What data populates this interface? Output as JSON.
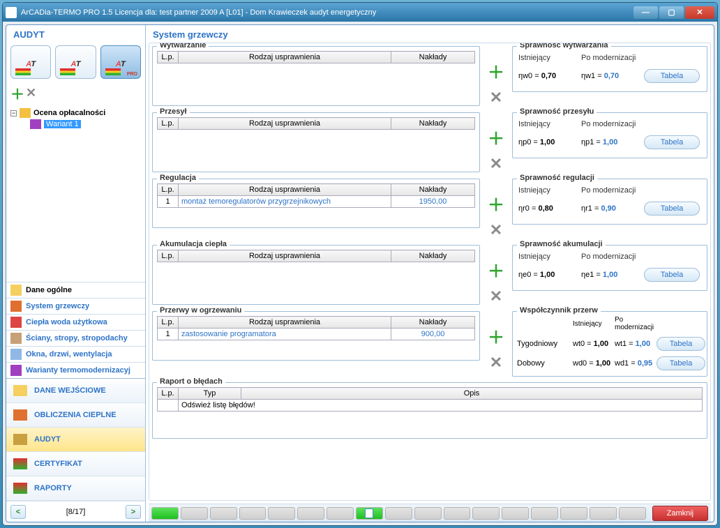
{
  "window": {
    "title": "ArCADia-TERMO PRO 1.5 Licencja dla: test partner 2009 A [L01] - Dom Krawieczek audyt energetyczny"
  },
  "sidebar": {
    "title": "AUDYT",
    "tree": {
      "root_label": "Ocena opłacalności",
      "child_label": "Wariant 1"
    },
    "nav": [
      "Dane ogólne",
      "System grzewczy",
      "Ciepła woda użytkowa",
      "Ściany, stropy, stropodachy",
      "Okna, drzwi, wentylacja",
      "Warianty termomodernizacyj"
    ],
    "big": [
      "DANE WEJŚCIOWE",
      "OBLICZENIA CIEPLNE",
      "AUDYT",
      "CERTYFIKAT",
      "RAPORTY"
    ],
    "pager": "[8/17]"
  },
  "main": {
    "title": "System grzewczy",
    "col_lp": "L.p.",
    "col_rodzaj": "Rodzaj usprawnienia",
    "col_naklady": "Nakłady",
    "istniejacy": "Istniejący",
    "po_modern": "Po modernizacji",
    "tabela": "Tabela",
    "sections": {
      "wytwarzanie": {
        "legend": "Wytwarzanie",
        "right_title": "Sprawność wytwarzania",
        "sym0": "ηw0 =",
        "val0": "0,70",
        "sym1": "ηw1 =",
        "val1": "0,70"
      },
      "przesyl": {
        "legend": "Przesył",
        "right_title": "Sprawność przesyłu",
        "sym0": "ηp0 =",
        "val0": "1,00",
        "sym1": "ηp1 =",
        "val1": "1,00"
      },
      "regulacja": {
        "legend": "Regulacja",
        "right_title": "Sprawność regulacji",
        "row_lp": "1",
        "row_name": "montaż temoregulatorów przygrzejnikowych",
        "row_cost": "1950,00",
        "sym0": "ηr0 =",
        "val0": "0,80",
        "sym1": "ηr1 =",
        "val1": "0,90"
      },
      "akumulacja": {
        "legend": "Akumulacja ciepła",
        "right_title": "Sprawność akumulacji",
        "sym0": "ηe0 =",
        "val0": "1,00",
        "sym1": "ηe1 =",
        "val1": "1,00"
      },
      "przerwy": {
        "legend": "Przerwy w ogrzewaniu",
        "right_title": "Współczynnik przerw",
        "row_lp": "1",
        "row_name": "zastosowanie programatora",
        "row_cost": "900,00",
        "tyg_label": "Tygodniowy",
        "dob_label": "Dobowy",
        "t_sym0": "wt0 =",
        "t_val0": "1,00",
        "t_sym1": "wt1 =",
        "t_val1": "1,00",
        "d_sym0": "wd0 =",
        "d_val0": "1,00",
        "d_sym1": "wd1 =",
        "d_val1": "0,95"
      }
    },
    "report": {
      "legend": "Raport o błędach",
      "col_lp": "L.p.",
      "col_typ": "Typ",
      "col_opis": "Opis",
      "msg": "Odśwież listę błędów!"
    }
  },
  "footer": {
    "close": "Zamknij"
  }
}
